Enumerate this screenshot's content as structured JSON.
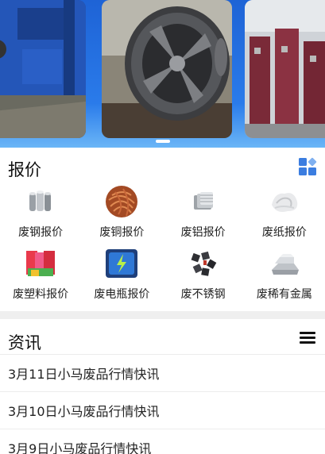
{
  "carousel": {
    "slides": [
      "baler-machine-photo",
      "gear-wheel-photo",
      "scrap-parts-photo"
    ],
    "active_index": 1
  },
  "quote": {
    "title": "报价",
    "items": [
      {
        "label": "废钢报价",
        "icon": "steel-pipe-icon"
      },
      {
        "label": "废铜报价",
        "icon": "copper-wire-icon"
      },
      {
        "label": "废铝报价",
        "icon": "aluminum-icon"
      },
      {
        "label": "废纸报价",
        "icon": "paper-icon"
      },
      {
        "label": "废塑料报价",
        "icon": "plastic-icon"
      },
      {
        "label": "废电瓶报价",
        "icon": "battery-icon"
      },
      {
        "label": "废不锈钢",
        "icon": "stainless-steel-icon"
      },
      {
        "label": "废稀有金属",
        "icon": "rare-metal-icon"
      }
    ]
  },
  "news": {
    "title": "资讯",
    "items": [
      {
        "title": "3月11日小马废品行情快讯"
      },
      {
        "title": "3月10日小马废品行情快讯"
      },
      {
        "title": "3月9日小马废品行情快讯"
      }
    ]
  },
  "colors": {
    "brand_blue": "#2a7bea",
    "grid_icon_blue": "#3b7de0",
    "divider": "#efefef"
  }
}
